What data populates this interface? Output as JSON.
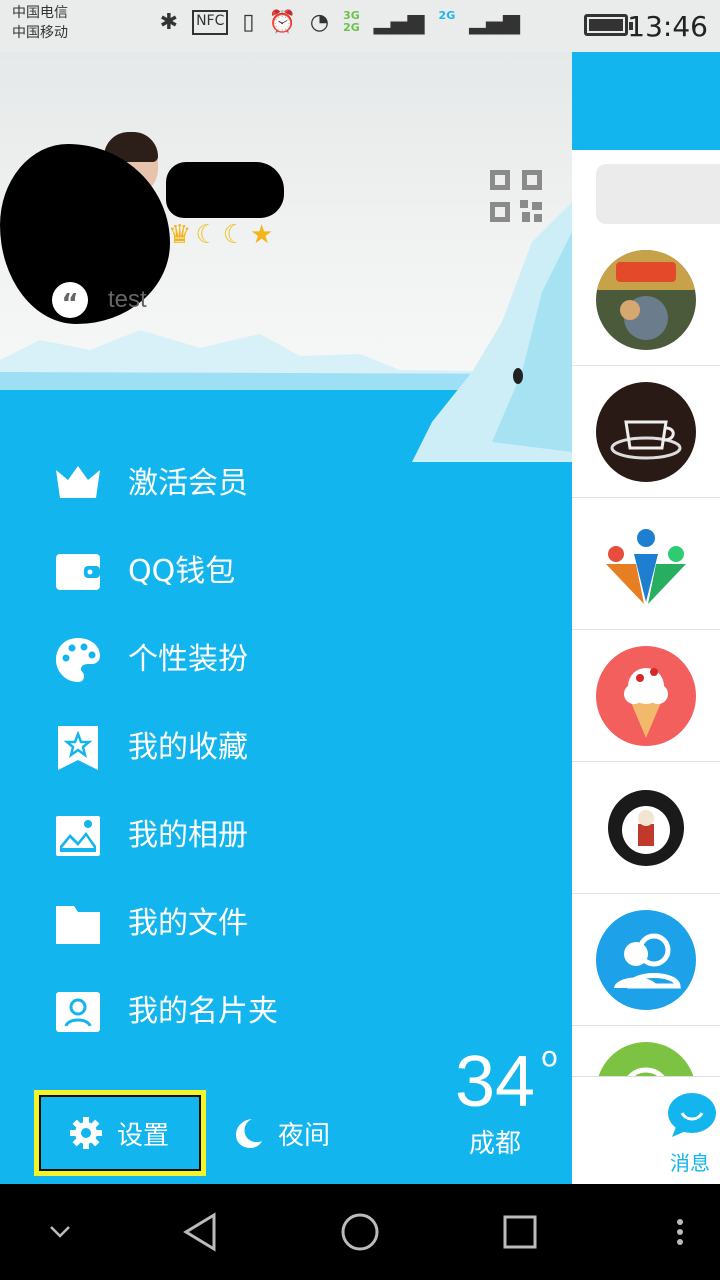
{
  "status_bar": {
    "carrier1": "中国电信",
    "carrier2": "中国移动",
    "net_3g": "3G",
    "net_2g_a": "2G",
    "net_2g_b": "2G",
    "time": "13:46",
    "icons": [
      "bluetooth-icon",
      "nfc-icon",
      "vibrate-icon",
      "alarm-icon",
      "wifi-icon",
      "signal-icon",
      "battery-icon"
    ]
  },
  "profile": {
    "signature": "test",
    "quote_mark": "“",
    "badges": [
      "crown",
      "moon",
      "moon",
      "star"
    ]
  },
  "menu": {
    "items": [
      {
        "label": "激活会员",
        "icon": "crown-icon"
      },
      {
        "label": "QQ钱包",
        "icon": "wallet-icon"
      },
      {
        "label": "个性装扮",
        "icon": "palette-icon"
      },
      {
        "label": "我的收藏",
        "icon": "bookmark-star-icon"
      },
      {
        "label": "我的相册",
        "icon": "image-icon"
      },
      {
        "label": "我的文件",
        "icon": "folder-icon"
      },
      {
        "label": "我的名片夹",
        "icon": "contact-card-icon"
      }
    ]
  },
  "bottom": {
    "settings_label": "设置",
    "night_label": "夜间",
    "weather": {
      "temp": "34",
      "degree": "o",
      "city": "成都"
    }
  },
  "peek": {
    "messages_tab_label": "消息"
  },
  "colors": {
    "accent": "#12b5ee",
    "highlight_border": "#f3f52a"
  }
}
